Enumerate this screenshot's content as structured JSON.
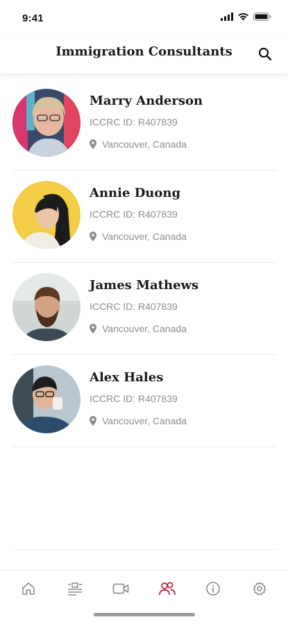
{
  "status_bar": {
    "time": "9:41"
  },
  "header": {
    "title": "Immigration Consultants"
  },
  "colors": {
    "accent": "#c8102e",
    "tab_inactive": "#8a8a8a",
    "muted_text": "#8d8d8d"
  },
  "consultants": [
    {
      "name": "Marry Anderson",
      "iccrc": "ICCRC ID: R407839",
      "location": "Vancouver, Canada"
    },
    {
      "name": "Annie Duong",
      "iccrc": "ICCRC ID: R407839",
      "location": "Vancouver, Canada"
    },
    {
      "name": "James Mathews",
      "iccrc": "ICCRC ID: R407839",
      "location": "Vancouver, Canada"
    },
    {
      "name": "Alex Hales",
      "iccrc": "ICCRC ID: R407839",
      "location": "Vancouver, Canada"
    }
  ],
  "tab_bar": {
    "items": [
      {
        "icon": "home-icon",
        "active": false
      },
      {
        "icon": "news-icon",
        "active": false
      },
      {
        "icon": "video-camera-icon",
        "active": false
      },
      {
        "icon": "people-icon",
        "active": true
      },
      {
        "icon": "info-icon",
        "active": false
      },
      {
        "icon": "settings-gear-icon",
        "active": false
      }
    ]
  }
}
